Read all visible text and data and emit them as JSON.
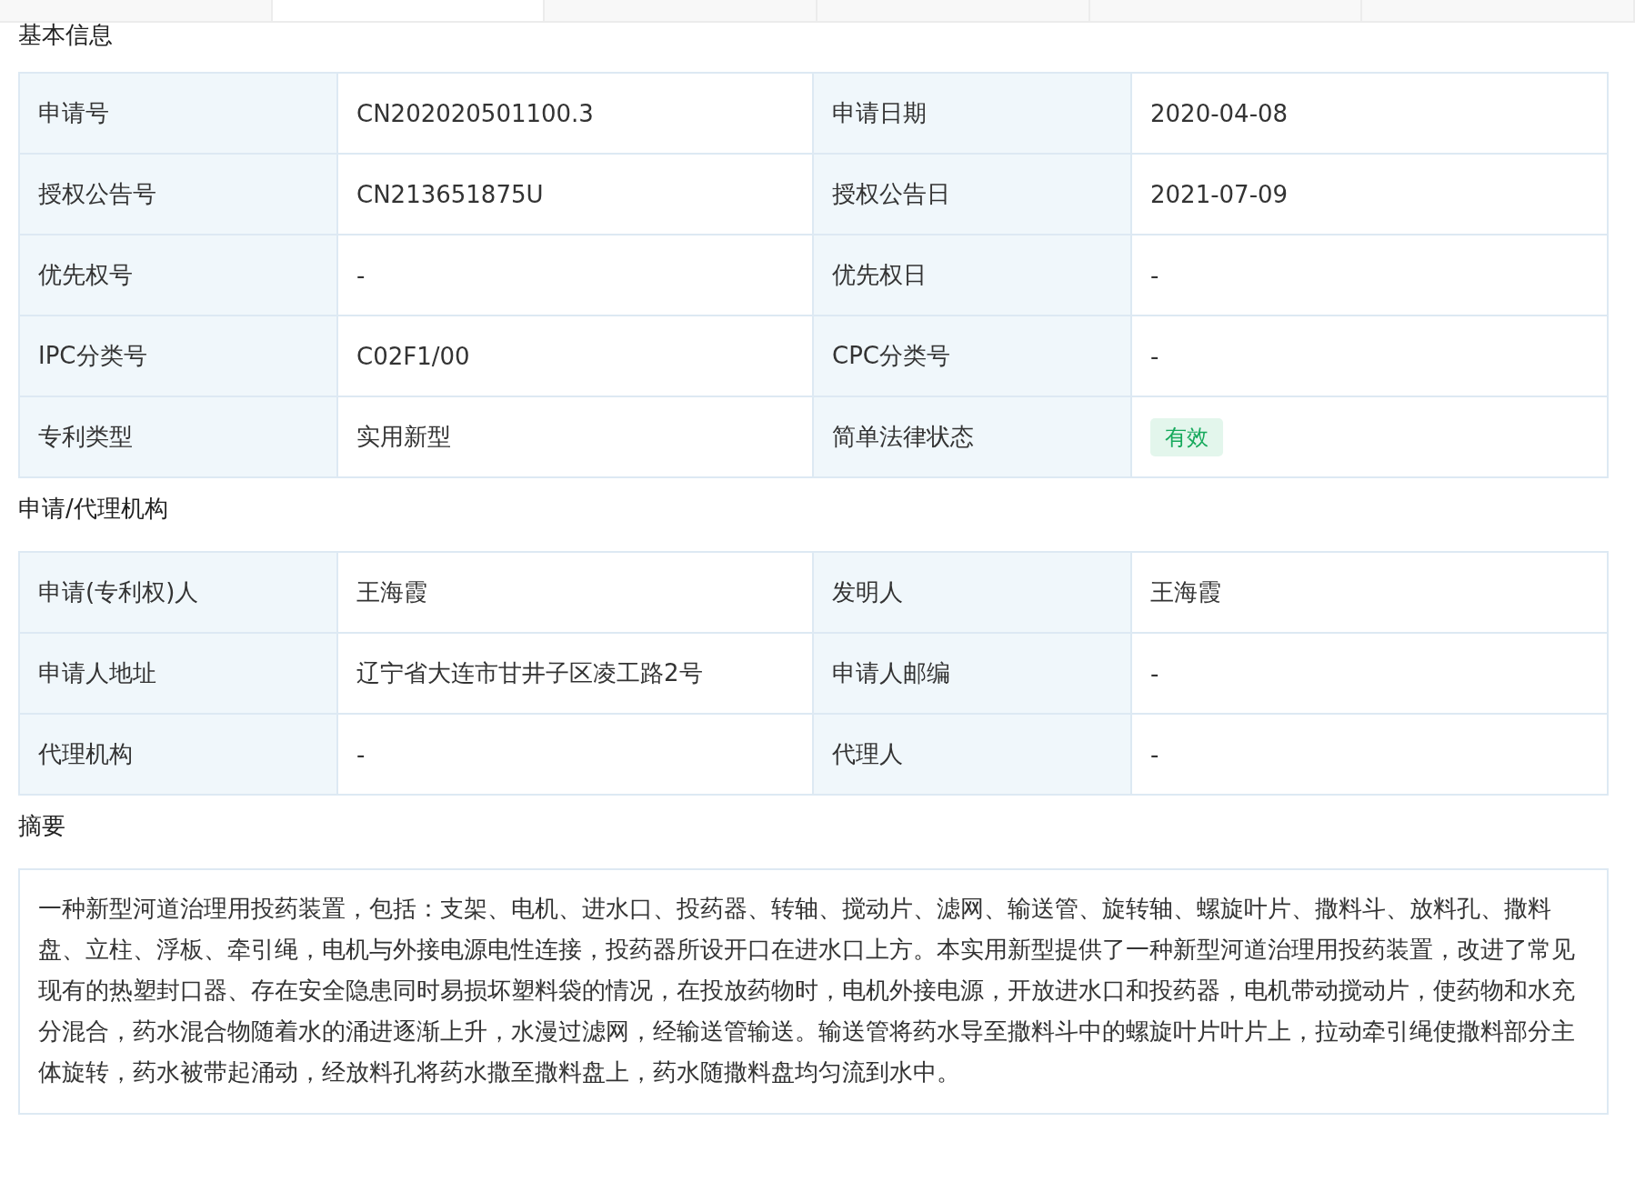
{
  "sections": [
    {
      "title": "基本信息",
      "kind": "table",
      "rows": [
        {
          "pairs": [
            {
              "label": "申请号",
              "value": "CN202020501100.3",
              "kind": "text"
            },
            {
              "label": "申请日期",
              "value": "2020-04-08",
              "kind": "text"
            }
          ]
        },
        {
          "pairs": [
            {
              "label": "授权公告号",
              "value": "CN213651875U",
              "kind": "text"
            },
            {
              "label": "授权公告日",
              "value": "2021-07-09",
              "kind": "text"
            }
          ]
        },
        {
          "pairs": [
            {
              "label": "优先权号",
              "value": "-",
              "kind": "text"
            },
            {
              "label": "优先权日",
              "value": "-",
              "kind": "text"
            }
          ]
        },
        {
          "pairs": [
            {
              "label": "IPC分类号",
              "value": "C02F1/00",
              "kind": "text"
            },
            {
              "label": "CPC分类号",
              "value": "-",
              "kind": "text"
            }
          ]
        },
        {
          "pairs": [
            {
              "label": "专利类型",
              "value": "实用新型",
              "kind": "text"
            },
            {
              "label": "简单法律状态",
              "value": "有效",
              "kind": "badge"
            }
          ]
        }
      ]
    },
    {
      "title": "申请/代理机构",
      "kind": "table",
      "rows": [
        {
          "pairs": [
            {
              "label": "申请(专利权)人",
              "value": "王海霞",
              "kind": "text"
            },
            {
              "label": "发明人",
              "value": "王海霞",
              "kind": "text"
            }
          ]
        },
        {
          "pairs": [
            {
              "label": "申请人地址",
              "value": "辽宁省大连市甘井子区凌工路2号",
              "kind": "text"
            },
            {
              "label": "申请人邮编",
              "value": "-",
              "kind": "text"
            }
          ]
        },
        {
          "pairs": [
            {
              "label": "代理机构",
              "value": "-",
              "kind": "text"
            },
            {
              "label": "代理人",
              "value": "-",
              "kind": "text"
            }
          ]
        }
      ]
    },
    {
      "title": "摘要",
      "kind": "paragraph",
      "text": "一种新型河道治理用投药装置，包括：支架、电机、进水口、投药器、转轴、搅动片、滤网、输送管、旋转轴、螺旋叶片、撒料斗、放料孔、撒料盘、立柱、浮板、牵引绳，电机与外接电源电性连接，投药器所设开口在进水口上方。本实用新型提供了一种新型河道治理用投药装置，改进了常见现有的热塑封口器、存在安全隐患同时易损坏塑料袋的情况，在投放药物时，电机外接电源，开放进水口和投药器，电机带动搅动片，使药物和水充分混合，药水混合物随着水的涌进逐渐上升，水漫过滤网，经输送管输送。输送管将药水导至撒料斗中的螺旋叶片叶片上，拉动牵引绳使撒料部分主体旋转，药水被带起涌动，经放料孔将药水撒至撒料盘上，药水随撒料盘均匀流到水中。"
    }
  ]
}
